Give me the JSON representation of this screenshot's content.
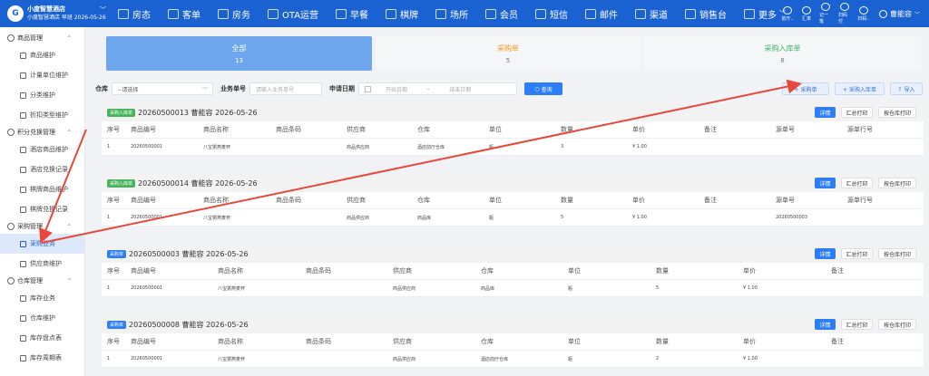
{
  "header": {
    "brand_name": "小度智慧酒店",
    "brand_sub": "小度智慧酒店 早班 2026-05-26",
    "nav": [
      "房态",
      "客单",
      "房务",
      "OTA运营",
      "早餐",
      "棋牌",
      "场所",
      "会员",
      "短信",
      "邮件",
      "渠道",
      "销售台",
      "更多"
    ],
    "tools": [
      "前厅..",
      "汇率",
      "记一笔",
      "扫码付",
      "扫码.."
    ],
    "user": "曹能容"
  },
  "sidebar": {
    "groups": [
      {
        "label": "商品管理",
        "items": [
          "商品维护",
          "计量单位维护",
          "分类维护",
          "折扣类型维护"
        ]
      },
      {
        "label": "积分兑换管理",
        "items": [
          "酒店商品维护",
          "酒店兑换记录",
          "棋牌商品维护",
          "棋牌兑换记录"
        ]
      },
      {
        "label": "采购管理",
        "items": [
          "采购业务",
          "供应商维护"
        ]
      },
      {
        "label": "仓库管理",
        "items": [
          "库存业务",
          "仓库维护",
          "库存盘点表",
          "库存周期表"
        ]
      }
    ]
  },
  "tabs": [
    {
      "label": "全部",
      "count": "13"
    },
    {
      "label": "采购单",
      "count": "5"
    },
    {
      "label": "采购入库单",
      "count": "8"
    }
  ],
  "filter": {
    "warehouse_label": "仓库",
    "warehouse_value": "--请选择",
    "order_label": "业务单号",
    "order_placeholder": "请输入业务单号",
    "date_label": "申请日期",
    "date_start": "开始日期",
    "date_sep": "-",
    "date_end": "结束日期",
    "query": "查询"
  },
  "actions": {
    "purchase": "+ 采购单",
    "inbound": "+ 采购入库单",
    "import": "导入"
  },
  "card_buttons": {
    "detail": "详情",
    "summary_print": "汇总打印",
    "warehouse_print": "按仓库打印"
  },
  "columns_inbound": [
    "序号",
    "商品编号",
    "商品名称",
    "商品条码",
    "供应商",
    "仓库",
    "单位",
    "数量",
    "单价",
    "备注",
    "源单号",
    "源单行号"
  ],
  "columns_purchase": [
    "序号",
    "商品编号",
    "商品名称",
    "商品条码",
    "供应商",
    "仓库",
    "单位",
    "数量",
    "单价",
    "备注"
  ],
  "cards": [
    {
      "tag": "采购入库单",
      "tag_color": "green",
      "title": "20260500013 曹能容 2026-05-26",
      "row": [
        "1",
        "20260500001",
        "八宝粥燕麦杯",
        "",
        "商品供应商",
        "酒店前厅仓库",
        "瓶",
        "3",
        "¥ 1.00",
        "",
        "",
        ""
      ]
    },
    {
      "tag": "采购入库单",
      "tag_color": "green",
      "title": "20260500014 曹能容 2026-05-26",
      "row": [
        "1",
        "20260500001",
        "八宝粥燕麦杯",
        "",
        "商品供应商",
        "商品库",
        "瓶",
        "5",
        "¥ 1.00",
        "",
        "20260500003",
        ""
      ]
    },
    {
      "tag": "采购单",
      "tag_color": "blue",
      "title": "20260500003 曹能容 2026-05-26",
      "row": [
        "1",
        "20260500001",
        "八宝粥燕麦杯",
        "",
        "商品供应商",
        "商品库",
        "瓶",
        "5",
        "¥ 1.00",
        ""
      ]
    },
    {
      "tag": "采购单",
      "tag_color": "blue",
      "title": "20260500008 曹能容 2026-05-26",
      "row": [
        "1",
        "20260500001",
        "八宝粥燕麦杯",
        "",
        "商品供应商",
        "酒店前厅仓库",
        "瓶",
        "2",
        "¥ 1.00",
        ""
      ]
    }
  ],
  "colors": {
    "primary": "#1a62d1",
    "tab_active": "#6ea6ee",
    "orange": "#f59a23",
    "green": "#3eb56a",
    "arrow": "#e8483b"
  }
}
